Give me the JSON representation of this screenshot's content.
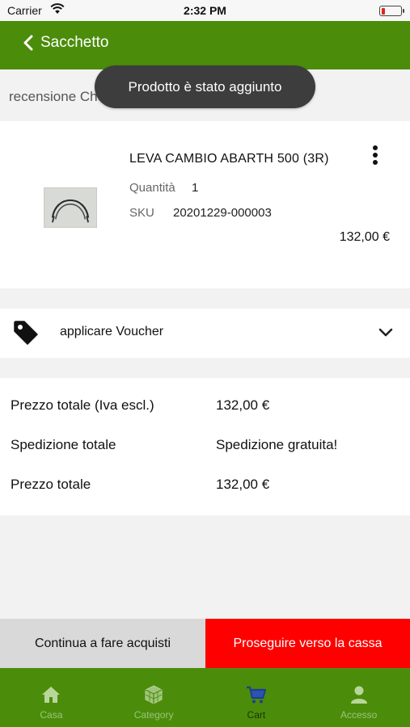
{
  "status_bar": {
    "carrier": "Carrier",
    "time": "2:32 PM",
    "battery_level": 0.1
  },
  "nav": {
    "back_label": "Sacchetto"
  },
  "review": {
    "text": "recensione Checkout"
  },
  "toast": {
    "text": "Prodotto è stato aggiunto"
  },
  "product": {
    "name": "LEVA CAMBIO ABARTH 500 (3R)",
    "quantity_label": "Quantità",
    "quantity": "1",
    "sku_label": "SKU",
    "sku": "20201229-000003",
    "price": "132,00 €"
  },
  "voucher": {
    "label": "applicare Voucher",
    "icon": "tag-icon"
  },
  "totals": {
    "rows": [
      {
        "label": "Prezzo totale (Iva escl.)",
        "value": "132,00 €"
      },
      {
        "label": "Spedizione totale",
        "value": "Spedizione gratuita!"
      },
      {
        "label": "Prezzo totale",
        "value": "132,00 €"
      }
    ]
  },
  "actions": {
    "continue_label": "Continua a fare acquisti",
    "checkout_label": "Proseguire verso la cassa"
  },
  "tabbar": {
    "tabs": [
      {
        "label": "Casa",
        "icon": "home-icon"
      },
      {
        "label": "Category",
        "icon": "cube-icon"
      },
      {
        "label": "Cart",
        "icon": "cart-icon",
        "active": true
      },
      {
        "label": "Accesso",
        "icon": "user-icon"
      }
    ]
  },
  "colors": {
    "brand_green": "#4b8d0b",
    "checkout_red": "#ff0000",
    "toast_bg": "#3d3d3d",
    "tab_inactive": "#9fc37a",
    "tab_active": "#1a3306"
  }
}
